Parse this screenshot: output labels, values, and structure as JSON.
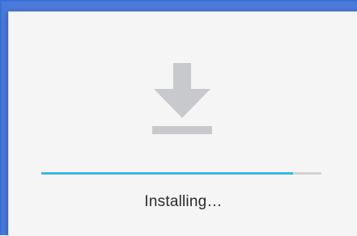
{
  "dialog": {
    "status_text": "Installing…",
    "icon": "download-icon",
    "progress": {
      "value": 0.9
    }
  },
  "colors": {
    "accent": "#3cb6e8",
    "icon": "#c7c9cc",
    "background": "#f5f5f5"
  }
}
